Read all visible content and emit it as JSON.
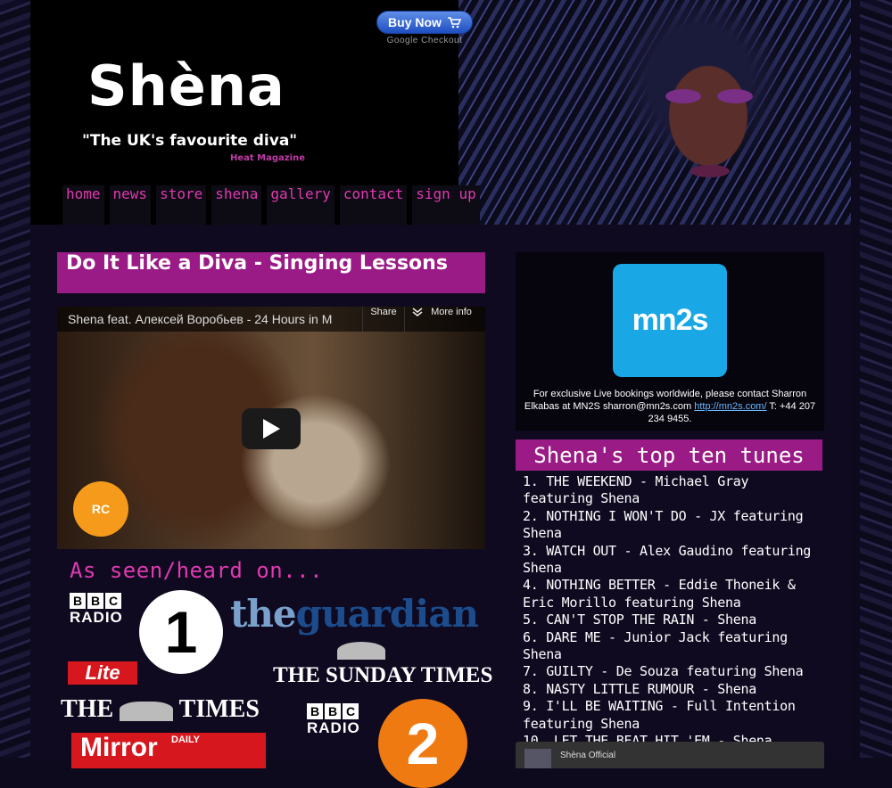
{
  "header": {
    "buy_now": "Buy Now",
    "google_checkout": "Google Checkout",
    "logo": "Shèna",
    "tagline": "\"The UK's favourite diva\"",
    "tagline_source": "Heat Magazine"
  },
  "nav": [
    "home",
    "news",
    "store",
    "shena",
    "gallery",
    "contact",
    "sign up"
  ],
  "main": {
    "section_title": "Do It Like a Diva - Singing Lessons",
    "video": {
      "title": "Shena feat. Алексей Воробьев - 24 Hours in M",
      "share_label": "Share",
      "more_info_label": "More info",
      "badge": "RC"
    },
    "seen_heard_title": "As seen/heard on...",
    "media_logos": {
      "bbc_letters": [
        "B",
        "B",
        "C"
      ],
      "bbc_radio": "RADIO",
      "radio1": "1",
      "guardian_the": "the",
      "guardian_name": "guardian",
      "sunday_times": "THE SUNDAY TIMES",
      "lite": "Lite",
      "the_times_left": "THE",
      "the_times_right": "TIMES",
      "radio2": "2",
      "mirror": "Mirror",
      "mirror_daily": "DAILY"
    }
  },
  "sidebar": {
    "mn2s_logo": "mn2s",
    "booking_text": "For exclusive Live bookings worldwide, please contact Sharron Elkabas at MN2S sharron@mn2s.com",
    "booking_link": "http://mn2s.com/",
    "booking_tail": "T: +44 207 234 9455.",
    "top_ten_title": "Shena's top ten tunes",
    "top_ten": [
      "1. THE WEEKEND - Michael Gray featuring Shena",
      "2. NOTHING I WON'T DO - JX featuring Shena",
      "3. WATCH OUT - Alex Gaudino featuring Shena",
      "4. NOTHING BETTER - Eddie Thoneik & Eric Morillo featuring Shena",
      "5. CAN'T STOP THE RAIN - Shena",
      "6. DARE ME - Junior Jack featuring Shena",
      "7. GUILTY - De Souza featuring Shena",
      "8. NASTY LITTLE RUMOUR - Shena",
      "9. I'LL BE WAITING - Full Intention featuring Shena",
      "10. LET THE BEAT HIT 'EM - Shena"
    ],
    "facebook_name": "Shèna Official"
  },
  "colors": {
    "accent": "#9b1b86",
    "nav_text": "#e03ab0",
    "background": "#0c0a1c"
  }
}
